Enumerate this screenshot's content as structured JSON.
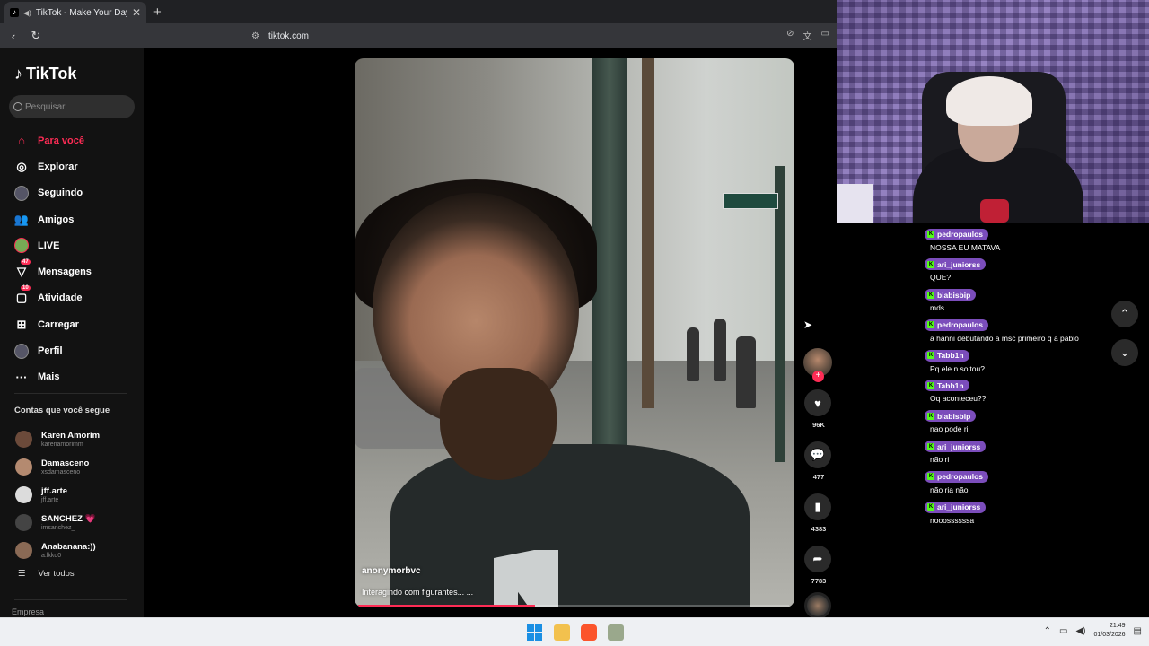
{
  "browser": {
    "tab_title": "TikTok - Make Your Day",
    "address": "tiktok.com"
  },
  "sidebar": {
    "logo": "TikTok",
    "search_placeholder": "Pesquisar",
    "nav": [
      {
        "label": "Para você",
        "icon": "home-icon",
        "active": true
      },
      {
        "label": "Explorar",
        "icon": "compass-icon"
      },
      {
        "label": "Seguindo",
        "icon": "following-avatar-icon"
      },
      {
        "label": "Amigos",
        "icon": "friends-icon"
      },
      {
        "label": "LIVE",
        "icon": "live-icon"
      },
      {
        "label": "Mensagens",
        "icon": "messages-icon",
        "badge": "47"
      },
      {
        "label": "Atividade",
        "icon": "activity-icon",
        "badge": "10"
      },
      {
        "label": "Carregar",
        "icon": "upload-icon"
      },
      {
        "label": "Perfil",
        "icon": "profile-icon"
      },
      {
        "label": "Mais",
        "icon": "more-icon"
      }
    ],
    "following_title": "Contas que você segue",
    "following": [
      {
        "name": "Karen Amorim",
        "handle": "karenamorimm",
        "color": "#6b4a3a"
      },
      {
        "name": "Damasceno",
        "handle": "xsdamasceno",
        "color": "#b48a70"
      },
      {
        "name": "jff.arte",
        "handle": "jff.arte",
        "color": "#dcdcdc"
      },
      {
        "name": "SANCHEZ 💗",
        "handle": "imsanchez_",
        "color": "#444"
      },
      {
        "name": "Anabanana:))",
        "handle": "a.lkko0",
        "color": "#8a6a55"
      }
    ],
    "see_all": "Ver todos",
    "footer": "Empresa"
  },
  "video": {
    "username": "anonymorbvc",
    "caption": "Interagindo com figurantes... ...",
    "progress": 0.41
  },
  "actions": {
    "likes": "96K",
    "comments": "477",
    "saves": "4383",
    "shares": "7783"
  },
  "chat": [
    {
      "user": "pedropaulos",
      "text": "NOSSA EU MATAVA"
    },
    {
      "user": "ari_juniorss",
      "text": "QUE?"
    },
    {
      "user": "biabisbip",
      "text": "mds"
    },
    {
      "user": "pedropaulos",
      "text": "a hanni debutando a msc primeiro q a pablo"
    },
    {
      "user": "Tabb1n",
      "text": "Pq ele n soltou?"
    },
    {
      "user": "Tabb1n",
      "text": "Oq aconteceu??"
    },
    {
      "user": "biabisbip",
      "text": "nao pode ri"
    },
    {
      "user": "ari_juniorss",
      "text": "não ri"
    },
    {
      "user": "pedropaulos",
      "text": "não ria não"
    },
    {
      "user": "ari_juniorss",
      "text": "nooossssssa"
    }
  ],
  "taskbar": {
    "time": "21:49",
    "date": "01/03/2026"
  },
  "colors": {
    "accent": "#fe2c55",
    "chat_badge": "#7b4dbb",
    "kick_green": "#53fc18"
  }
}
